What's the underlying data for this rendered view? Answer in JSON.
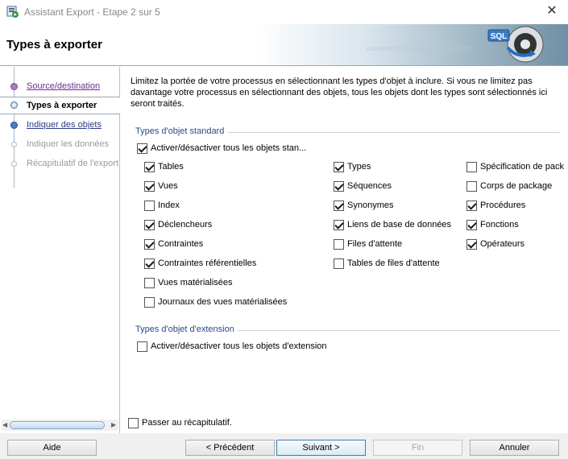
{
  "window": {
    "title": "Assistant Export - Etape 2 sur 5",
    "icon": "wizard-app-icon",
    "close_glyph": "✕"
  },
  "header": {
    "title": "Types à exporter",
    "binary_text": "0101010101010101010101010101",
    "logo_text": "SQL",
    "colors": {
      "gradient_end": "#6f8fa3"
    }
  },
  "sidebar": {
    "steps": [
      {
        "label": "Source/destination",
        "state": "visited"
      },
      {
        "label": "Types à exporter",
        "state": "active"
      },
      {
        "label": "Indiquer des objets",
        "state": "link"
      },
      {
        "label": "Indiquer les données",
        "state": "disabled"
      },
      {
        "label": "Récapitulatif de l'export",
        "state": "disabled"
      }
    ]
  },
  "content": {
    "intro": "Limitez la portée de votre processus en sélectionnant les types d'objet à inclure. Si vous ne limitez pas davantage votre processus en sélectionnant des objets, tous les objets dont les types sont sélectionnés ici seront traités.",
    "standard_group": {
      "title": "Types d'objet standard",
      "toggle_all": {
        "label": "Activer/désactiver tous les objets stan...",
        "checked": true
      },
      "col1": [
        {
          "label": "Tables",
          "checked": true
        },
        {
          "label": "Vues",
          "checked": true
        },
        {
          "label": "Index",
          "checked": false
        },
        {
          "label": "Déclencheurs",
          "checked": true
        },
        {
          "label": "Contraintes",
          "checked": true
        },
        {
          "label": "Contraintes référentielles",
          "checked": true
        },
        {
          "label": "Vues matérialisées",
          "checked": false
        },
        {
          "label": "Journaux des vues matérialisées",
          "checked": false
        }
      ],
      "col2": [
        {
          "label": "Types",
          "checked": true
        },
        {
          "label": "Séquences",
          "checked": true
        },
        {
          "label": "Synonymes",
          "checked": true
        },
        {
          "label": "Liens de base de données",
          "checked": true
        },
        {
          "label": "Files d'attente",
          "checked": false
        },
        {
          "label": "Tables de files d'attente",
          "checked": false
        }
      ],
      "col3": [
        {
          "label": "Spécification de pack",
          "checked": false
        },
        {
          "label": "Corps de package",
          "checked": false
        },
        {
          "label": "Procédures",
          "checked": true
        },
        {
          "label": "Fonctions",
          "checked": true
        },
        {
          "label": "Opérateurs",
          "checked": true
        }
      ]
    },
    "extension_group": {
      "title": "Types d'objet d'extension",
      "toggle_all": {
        "label": "Activer/désactiver tous les objets d'extension",
        "checked": false
      }
    },
    "skip_summary": {
      "label": "Passer au récapitulatif.",
      "checked": false
    }
  },
  "buttons": {
    "help": "Aide",
    "previous": "< Précédent",
    "next": "Suivant >",
    "finish": "Fin",
    "cancel": "Annuler"
  }
}
